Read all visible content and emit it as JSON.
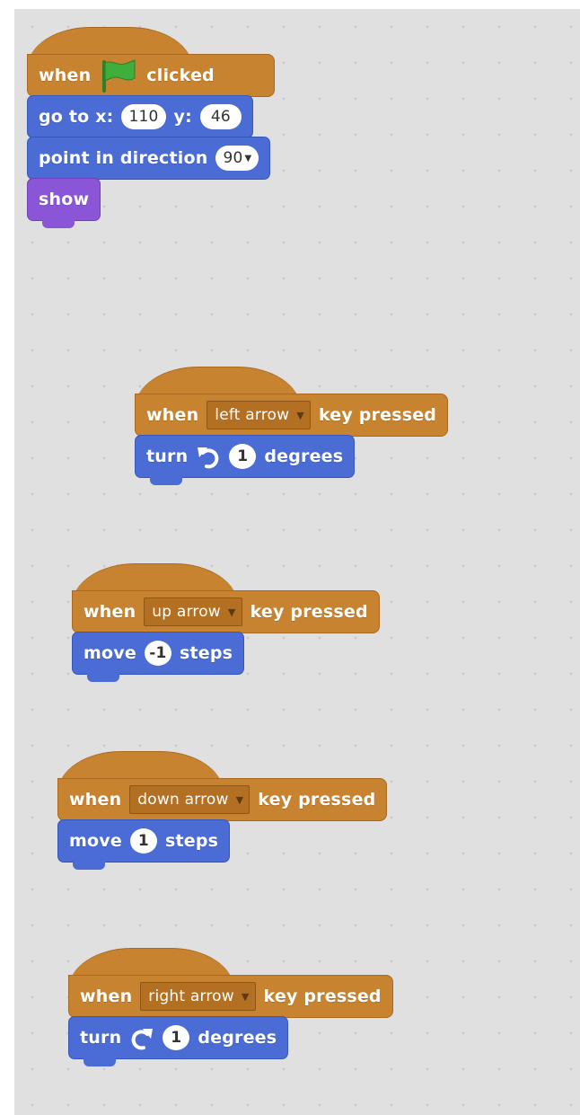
{
  "scripts": {
    "green_flag": {
      "hat_when": "when",
      "hat_clicked": "clicked",
      "goto_label": "go to x:",
      "goto_x": "110",
      "goto_y_label": "y:",
      "goto_y": "46",
      "point_label": "point in direction",
      "point_value": "90",
      "show_label": "show"
    },
    "left_arrow": {
      "when": "when",
      "key": "left arrow",
      "key_pressed": "key pressed",
      "turn": "turn",
      "value": "1",
      "degrees": "degrees"
    },
    "up_arrow": {
      "when": "when",
      "key": "up arrow",
      "key_pressed": "key pressed",
      "move": "move",
      "value": "-1",
      "steps": "steps"
    },
    "down_arrow": {
      "when": "when",
      "key": "down arrow",
      "key_pressed": "key pressed",
      "move": "move",
      "value": "1",
      "steps": "steps"
    },
    "right_arrow": {
      "when": "when",
      "key": "right arrow",
      "key_pressed": "key pressed",
      "turn": "turn",
      "value": "1",
      "degrees": "degrees"
    }
  },
  "icons": {
    "green_flag": "green-flag-icon",
    "turn_left": "rotate-counterclockwise-icon",
    "turn_right": "rotate-clockwise-icon"
  },
  "colors": {
    "events": "#c88330",
    "motion": "#4a6cd4",
    "looks": "#8a55d7",
    "flag": "#3fae3a"
  }
}
